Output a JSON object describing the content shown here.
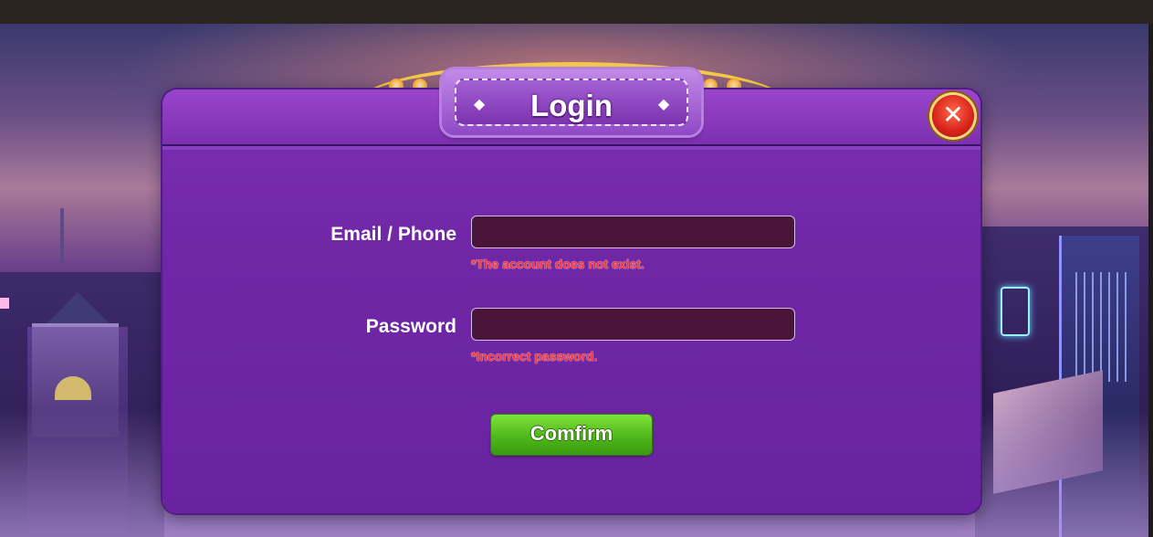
{
  "dialog": {
    "title": "Login",
    "close_icon": "close-icon",
    "title_ornament_icon": "diamond-icon"
  },
  "form": {
    "email_label": "Email / Phone",
    "email_value": "",
    "email_error": "*The account  does not exist.",
    "password_label": "Password",
    "password_value": "",
    "password_error": "*Incorrect password."
  },
  "actions": {
    "confirm_label": "Comfirm"
  },
  "colors": {
    "dialog_bg": "#6f27a6",
    "input_bg": "#4a1538",
    "error": "#ff2b2b",
    "confirm_button": "#4fb71b",
    "close_button": "#d8231a"
  }
}
